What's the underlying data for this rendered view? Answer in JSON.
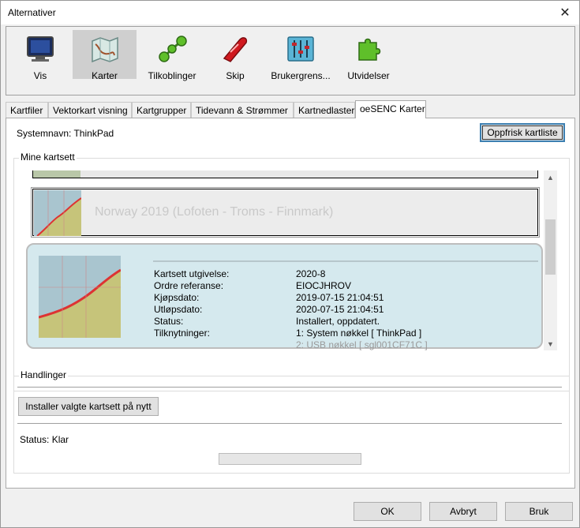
{
  "window": {
    "title": "Alternativer",
    "close_symbol": "✕"
  },
  "toolbar": {
    "items": [
      {
        "label": "Vis",
        "icon": "monitor-icon"
      },
      {
        "label": "Karter",
        "icon": "chart-map-icon",
        "selected": true
      },
      {
        "label": "Tilkoblinger",
        "icon": "connections-icon"
      },
      {
        "label": "Skip",
        "icon": "ship-icon"
      },
      {
        "label": "Brukergrens...",
        "icon": "sliders-icon"
      },
      {
        "label": "Utvidelser",
        "icon": "puzzle-icon"
      }
    ]
  },
  "tabs": [
    {
      "label": "Kartfiler"
    },
    {
      "label": "Vektorkart visning"
    },
    {
      "label": "Kartgrupper"
    },
    {
      "label": "Tidevann & Strømmer"
    },
    {
      "label": "Kartnedlaster"
    },
    {
      "label": "oeSENC Karter",
      "active": true
    }
  ],
  "panel": {
    "system_name": "Systemnavn: ThinkPad",
    "refresh_button": "Oppfrisk kartliste",
    "my_chartsets": {
      "title": "Mine kartsett",
      "collapsed_item": {
        "name": "Norway 2019 (Lofoten - Troms - Finnmark)"
      },
      "expanded_item": {
        "rows": [
          {
            "key": "Kartsett utgivelse:",
            "value": "2020-8"
          },
          {
            "key": "Ordre referanse:",
            "value": "EIOCJHROV"
          },
          {
            "key": "Kjøpsdato:",
            "value": "2019-07-15 21:04:51"
          },
          {
            "key": "Utløpsdato:",
            "value": "2020-07-15 21:04:51"
          },
          {
            "key": "Status:",
            "value": "Installert, oppdatert."
          },
          {
            "key": "Tilknytninger:",
            "value": "1: System nøkkel  [ ThinkPad ]"
          },
          {
            "key": "",
            "value": "2: USB nøkkel  [ sgl001CF71C ]"
          }
        ]
      }
    },
    "actions": {
      "title": "Handlinger",
      "reinstall_button": "Installer valgte kartsett på nytt",
      "status": "Status: Klar",
      "progress": 0
    }
  },
  "buttons": {
    "ok": "OK",
    "cancel": "Avbryt",
    "apply": "Bruk"
  },
  "colors": {
    "selected_item_bg": "#d5e9ee",
    "focus_border": "#3c7fb1"
  }
}
